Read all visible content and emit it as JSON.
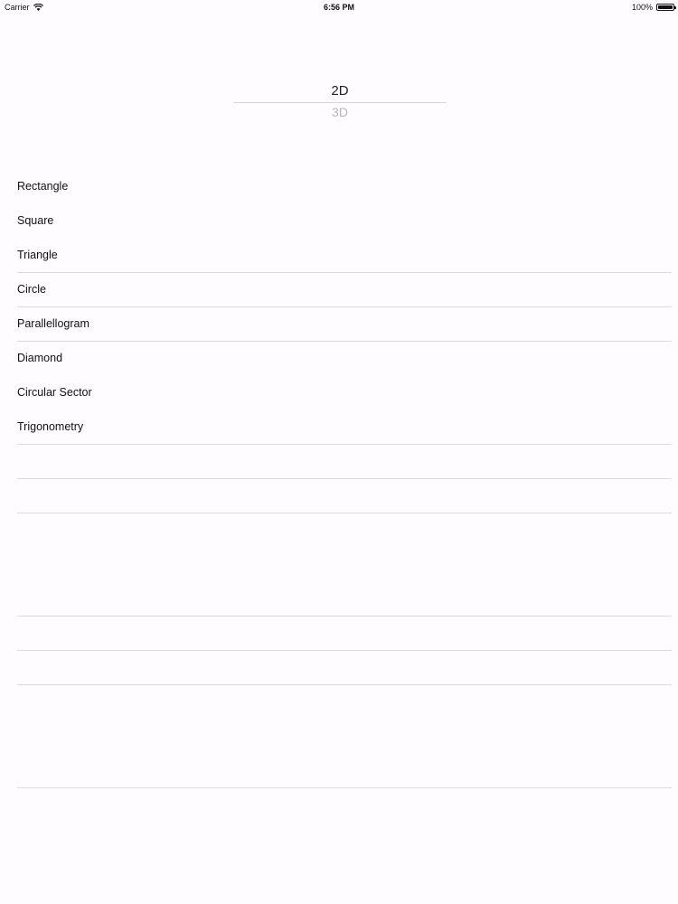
{
  "status_bar": {
    "carrier": "Carrier",
    "time": "6:56 PM",
    "battery": "100%"
  },
  "picker": {
    "options": [
      "2D",
      "3D"
    ],
    "selected": "2D"
  },
  "shapes": {
    "items": [
      "Rectangle",
      "Square",
      "Triangle",
      "Circle",
      "Parallellogram",
      "Diamond",
      "Circular Sector",
      "Trigonometry"
    ]
  },
  "icons": {
    "wifi": "wifi-icon",
    "battery": "battery-icon"
  }
}
